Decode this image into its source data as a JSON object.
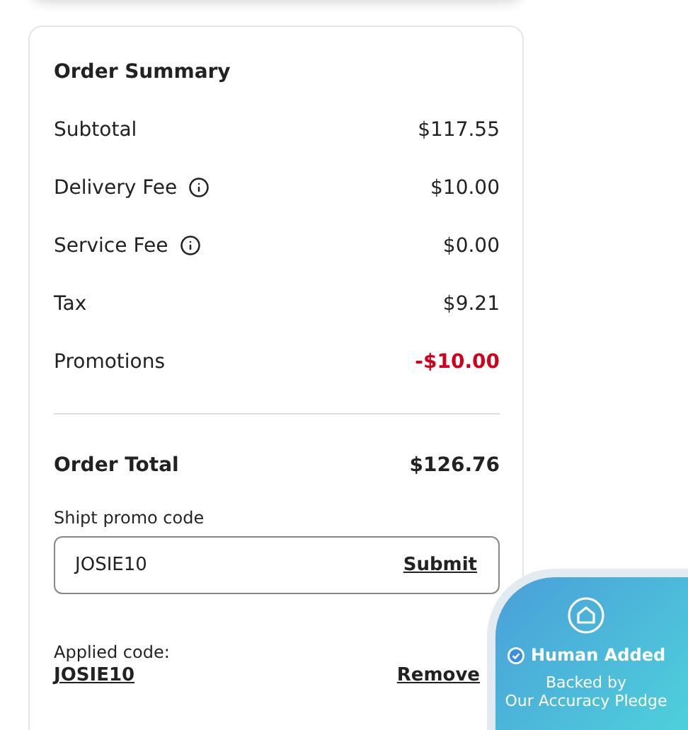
{
  "order_summary": {
    "title": "Order Summary",
    "rows": [
      {
        "label": "Subtotal",
        "value": "$117.55",
        "info": false,
        "kind": "charge"
      },
      {
        "label": "Delivery Fee",
        "value": "$10.00",
        "info": true,
        "kind": "charge"
      },
      {
        "label": "Service Fee",
        "value": "$0.00",
        "info": true,
        "kind": "charge"
      },
      {
        "label": "Tax",
        "value": "$9.21",
        "info": false,
        "kind": "charge"
      },
      {
        "label": "Promotions",
        "value": "-$10.00",
        "info": false,
        "kind": "discount"
      }
    ],
    "total": {
      "label": "Order Total",
      "value": "$126.76"
    },
    "promo": {
      "label": "Shipt promo code",
      "value": "JOSIE10",
      "button": "Submit"
    },
    "applied": {
      "label": "Applied code:",
      "code": "JOSIE10",
      "remove": "Remove"
    }
  },
  "badge": {
    "title": "Human Added",
    "subtitle": "Backed by",
    "pledge": "Our Accuracy Pledge"
  }
}
